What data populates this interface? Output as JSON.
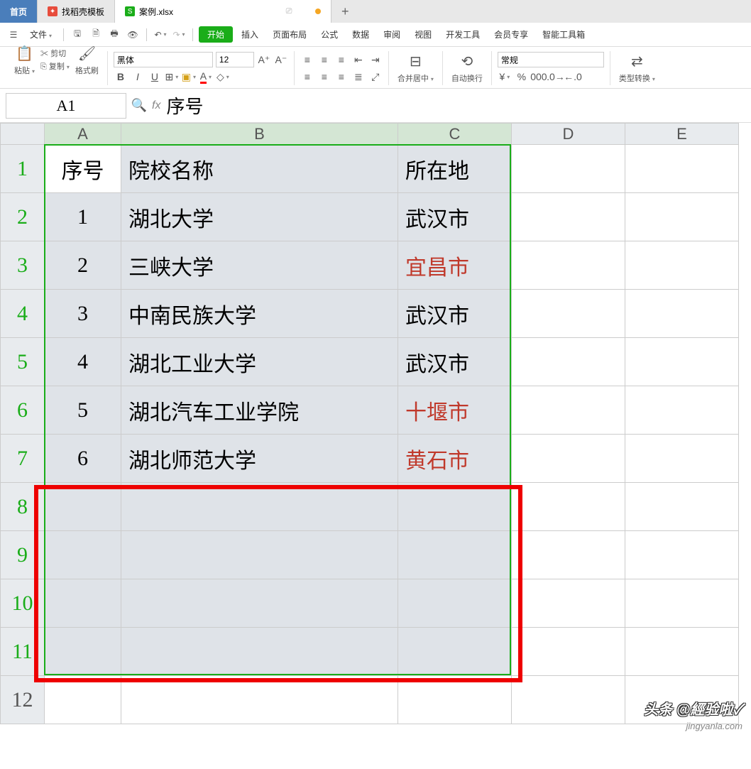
{
  "tabs": {
    "home": "首页",
    "template": "找稻壳模板",
    "file": "案例.xlsx"
  },
  "menu": {
    "file": "文件",
    "start": "开始",
    "insert": "插入",
    "pagelayout": "页面布局",
    "formula": "公式",
    "data": "数据",
    "review": "审阅",
    "view": "视图",
    "devtools": "开发工具",
    "member": "会员专享",
    "smarttools": "智能工具箱"
  },
  "ribbon": {
    "paste": "粘贴",
    "cut": "剪切",
    "copy": "复制",
    "formatpainter": "格式刷",
    "font": "黑体",
    "fontsize": "12",
    "merge": "合并居中",
    "wrap": "自动换行",
    "numfmt": "常规",
    "typeconv": "类型转换"
  },
  "namebox": "A1",
  "formula": "序号",
  "columns": [
    "A",
    "B",
    "C",
    "D",
    "E"
  ],
  "rows": [
    "1",
    "2",
    "3",
    "4",
    "5",
    "6",
    "7",
    "8",
    "9",
    "10",
    "11",
    "12"
  ],
  "table": {
    "headers": {
      "a": "序号",
      "b": "院校名称",
      "c": "所在地"
    },
    "data": [
      {
        "n": "1",
        "school": "湖北大学",
        "city": "武汉市",
        "red": false
      },
      {
        "n": "2",
        "school": "三峡大学",
        "city": "宜昌市",
        "red": true
      },
      {
        "n": "3",
        "school": "中南民族大学",
        "city": "武汉市",
        "red": false
      },
      {
        "n": "4",
        "school": "湖北工业大学",
        "city": "武汉市",
        "red": false
      },
      {
        "n": "5",
        "school": "湖北汽车工业学院",
        "city": "十堰市",
        "red": true
      },
      {
        "n": "6",
        "school": "湖北师范大学",
        "city": "黄石市",
        "red": true
      }
    ]
  },
  "watermark": "头条 @經验啦✓",
  "watermark_url": "jingyanla.com"
}
